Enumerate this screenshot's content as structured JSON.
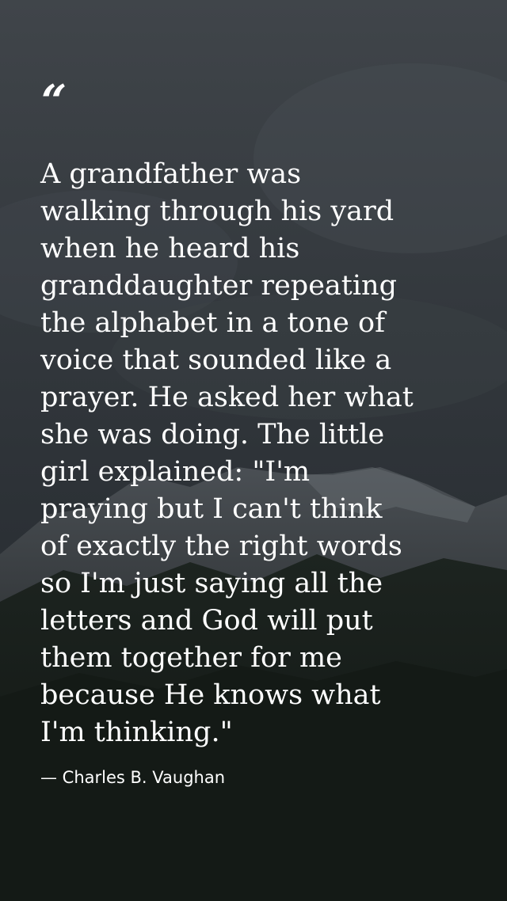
{
  "quote": {
    "open_mark": "“",
    "text": "A grandfather was\nwalking through his yard\nwhen he heard his\ngranddaughter repeating\nthe alphabet in a tone of\nvoice that sounded like a\nprayer. He asked her what\nshe was doing. The little\ngirl explained: \"I'm\npraying  but I can't think\nof exactly the right words\nso I'm just saying all the\nletters  and God will put\nthem together for me\nbecause He knows what\nI'm thinking.\"",
    "author": "— Charles B. Vaughan"
  },
  "colors": {
    "text": "#ffffff",
    "sky": "#3c4146",
    "forest": "#111612"
  }
}
